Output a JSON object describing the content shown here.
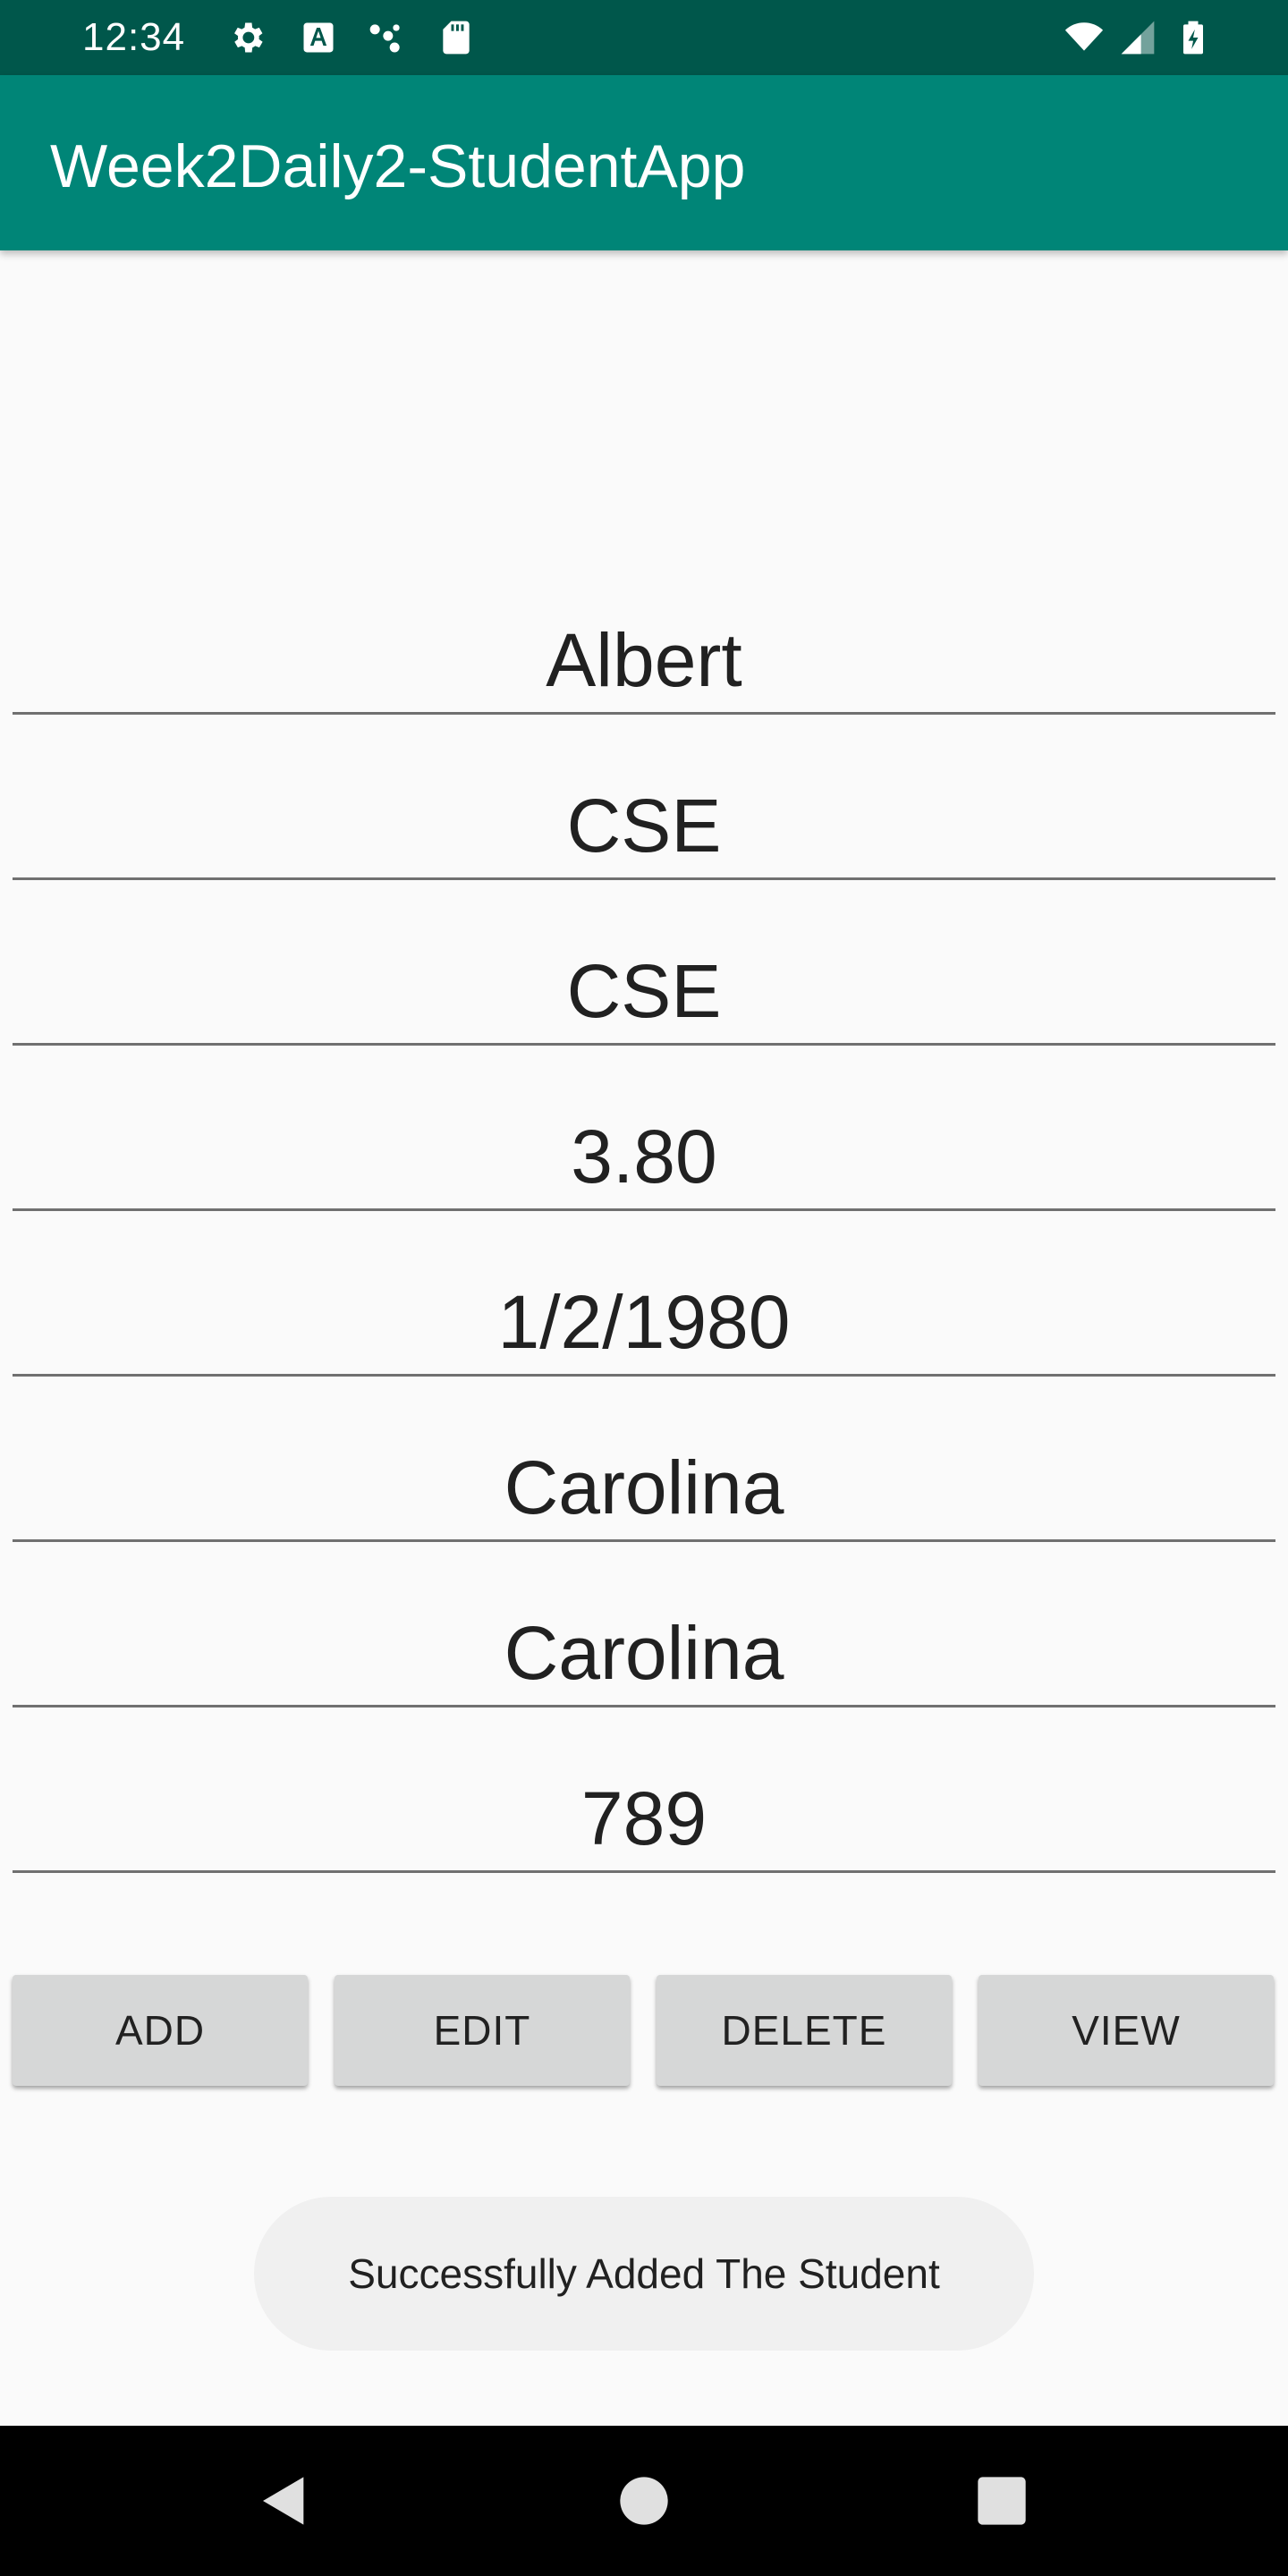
{
  "status_bar": {
    "time": "12:34",
    "left_icons": [
      "settings-icon",
      "text-a-icon",
      "dots-icon",
      "sd-card-icon"
    ],
    "right_icons": [
      "wifi-icon",
      "signal-icon",
      "battery-icon"
    ]
  },
  "app_bar": {
    "title": "Week2Daily2-StudentApp",
    "color": "#008577"
  },
  "form": {
    "fields": [
      "Albert",
      "CSE",
      "CSE",
      "3.80",
      "1/2/1980",
      "Carolina",
      "Carolina",
      "789"
    ]
  },
  "buttons": {
    "add": "ADD",
    "edit": "EDIT",
    "delete": "DELETE",
    "view": "VIEW"
  },
  "toast": {
    "message": "Successfully Added The Student"
  },
  "nav_bar": {
    "icons": [
      "back-icon",
      "home-icon",
      "recents-icon"
    ]
  }
}
